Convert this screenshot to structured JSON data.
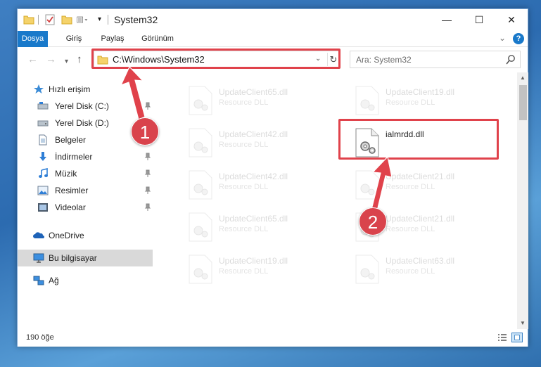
{
  "window": {
    "title": "System32",
    "controls": {
      "minimize": "—",
      "maximize": "☐",
      "close": "✕"
    }
  },
  "ribbon": {
    "tabs": [
      {
        "label": "Dosya",
        "active": true
      },
      {
        "label": "Giriş"
      },
      {
        "label": "Paylaş"
      },
      {
        "label": "Görünüm"
      }
    ],
    "help": "?"
  },
  "nav": {
    "back": "←",
    "forward": "→",
    "recent": "⌄",
    "up": "↑",
    "address": "C:\\Windows\\System32",
    "refresh": "↻",
    "search_placeholder": "Ara: System32"
  },
  "sidebar": {
    "items": [
      {
        "label": "Hızlı erişim",
        "icon": "star-icon"
      },
      {
        "label": "Yerel Disk (C:)",
        "icon": "drive-icon",
        "pinned": true
      },
      {
        "label": "Yerel Disk (D:)",
        "icon": "drive-icon"
      },
      {
        "label": "Belgeler",
        "icon": "documents-icon",
        "pinned": true
      },
      {
        "label": "İndirmeler",
        "icon": "download-icon",
        "pinned": true
      },
      {
        "label": "Müzik",
        "icon": "music-icon",
        "pinned": true
      },
      {
        "label": "Resimler",
        "icon": "pictures-icon",
        "pinned": true
      },
      {
        "label": "Videolar",
        "icon": "videos-icon",
        "pinned": true
      },
      {
        "label": "OneDrive",
        "icon": "onedrive-icon"
      },
      {
        "label": "Bu bilgisayar",
        "icon": "computer-icon",
        "selected": true
      },
      {
        "label": "Ağ",
        "icon": "network-icon"
      }
    ]
  },
  "files": [
    {
      "name": "UpdateClient65.dll",
      "type": "Resource DLL",
      "faded": true
    },
    {
      "name": "UpdateClient19.dll",
      "type": "Resource DLL",
      "faded": true
    },
    {
      "name": "UpdateClient42.dll",
      "type": "Resource DLL",
      "faded": true
    },
    {
      "name": "ialmrdd.dll",
      "type": "",
      "faded": false
    },
    {
      "name": "UpdateClient42.dll",
      "type": "Resource DLL",
      "faded": true
    },
    {
      "name": "UpdateClient21.dll",
      "type": "Resource DLL",
      "faded": true
    },
    {
      "name": "UpdateClient65.dll",
      "type": "Resource DLL",
      "faded": true
    },
    {
      "name": "UpdateClient21.dll",
      "type": "Resource DLL",
      "faded": true
    },
    {
      "name": "UpdateClient19.dll",
      "type": "Resource DLL",
      "faded": true
    },
    {
      "name": "UpdateClient63.dll",
      "type": "Resource DLL",
      "faded": true
    }
  ],
  "status": {
    "count": "190 öğe"
  },
  "annotations": {
    "step1": "1",
    "step2": "2",
    "color": "#e0424b"
  }
}
